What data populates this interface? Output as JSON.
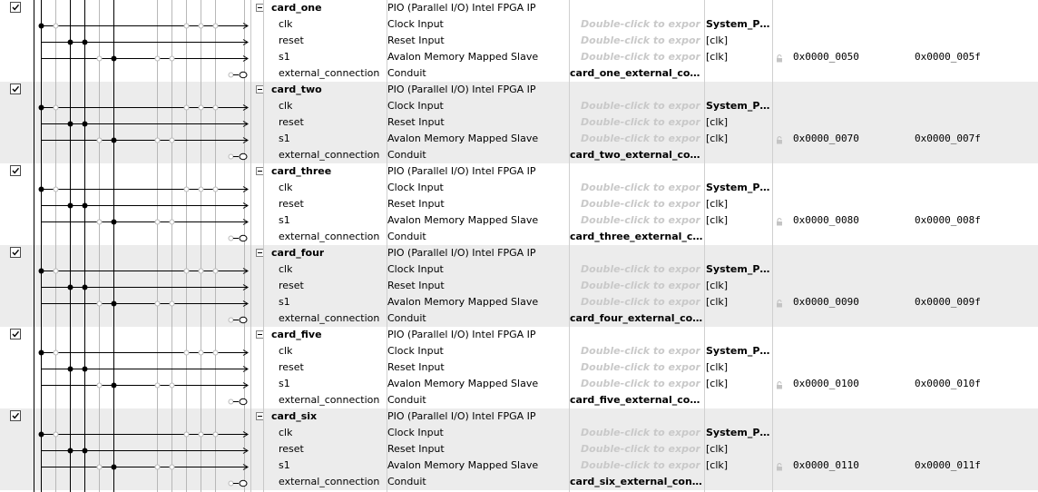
{
  "placeholder_export": "Double-click to export",
  "components": [
    {
      "name": "card_one",
      "type": "PIO (Parallel I/O) Intel FPGA IP",
      "base": "0x0000_0050",
      "end": "0x0000_005f",
      "export": "card_one_external_con..."
    },
    {
      "name": "card_two",
      "type": "PIO (Parallel I/O) Intel FPGA IP",
      "base": "0x0000_0070",
      "end": "0x0000_007f",
      "export": "card_two_external_con..."
    },
    {
      "name": "card_three",
      "type": "PIO (Parallel I/O) Intel FPGA IP",
      "base": "0x0000_0080",
      "end": "0x0000_008f",
      "export": "card_three_external_co..."
    },
    {
      "name": "card_four",
      "type": "PIO (Parallel I/O) Intel FPGA IP",
      "base": "0x0000_0090",
      "end": "0x0000_009f",
      "export": "card_four_external_con..."
    },
    {
      "name": "card_five",
      "type": "PIO (Parallel I/O) Intel FPGA IP",
      "base": "0x0000_0100",
      "end": "0x0000_010f",
      "export": "card_five_external_con..."
    },
    {
      "name": "card_six",
      "type": "PIO (Parallel I/O) Intel FPGA IP",
      "base": "0x0000_0110",
      "end": "0x0000_011f",
      "export": "card_six_external_conn..."
    }
  ],
  "ports": [
    {
      "name": "clk",
      "desc": "Clock Input",
      "clock": "System_PL..."
    },
    {
      "name": "reset",
      "desc": "Reset Input",
      "clock": "[clk]"
    },
    {
      "name": "s1",
      "desc": "Avalon Memory Mapped Slave",
      "clock": "[clk]"
    },
    {
      "name": "external_connection",
      "desc": "Conduit",
      "clock": ""
    }
  ],
  "colors": {
    "row_shaded": "#ececec",
    "placeholder": "#c9c9c9",
    "gridline": "#d0d0d0",
    "connection": "#000000",
    "hollow": "#b8b8b8"
  },
  "icons": {
    "checkbox": "checkbox-checked-icon",
    "collapse": "tree-collapse-icon",
    "lock": "lock-icon"
  }
}
